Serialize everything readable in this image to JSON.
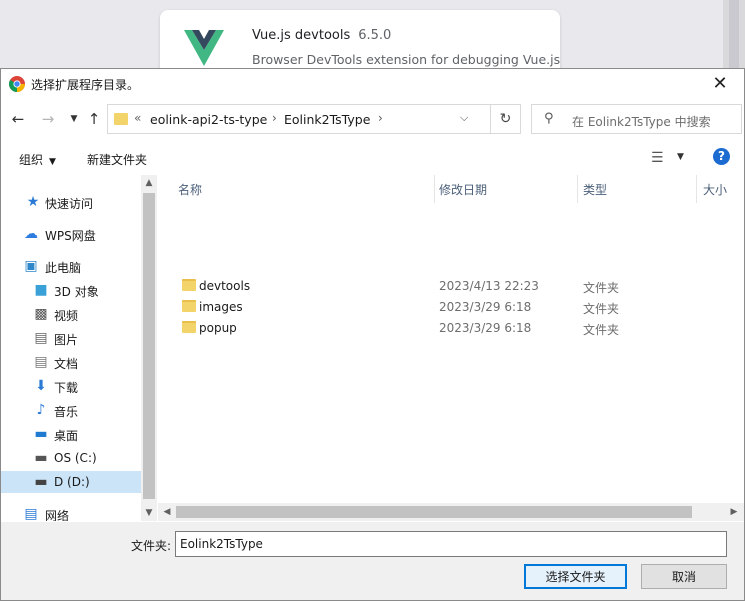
{
  "background": {
    "extension_name": "Vue.js devtools",
    "extension_version": "6.5.0",
    "extension_description": "Browser DevTools extension for debugging Vue.js"
  },
  "dialog": {
    "title": "选择扩展程序目录。",
    "close_glyph": "✕"
  },
  "address": {
    "overflow_glyph": "«",
    "crumbs": [
      "eolink-api2-ts-type",
      "Eolink2TsType"
    ],
    "separator": "›",
    "search_placeholder": "在 Eolink2TsType 中搜索"
  },
  "toolbar": {
    "organize": "组织",
    "new_folder": "新建文件夹"
  },
  "nav": {
    "items": [
      {
        "label": "快速访问",
        "icon": "star-icon"
      },
      {
        "label": "WPS网盘",
        "icon": "cloud-icon"
      },
      {
        "label": "此电脑",
        "icon": "computer-icon"
      },
      {
        "label": "3D 对象",
        "icon": "cube-icon"
      },
      {
        "label": "视频",
        "icon": "video-icon"
      },
      {
        "label": "图片",
        "icon": "picture-icon"
      },
      {
        "label": "文档",
        "icon": "document-icon"
      },
      {
        "label": "下载",
        "icon": "download-icon"
      },
      {
        "label": "音乐",
        "icon": "music-icon"
      },
      {
        "label": "桌面",
        "icon": "desktop-icon"
      },
      {
        "label": "OS (C:)",
        "icon": "drive-icon"
      },
      {
        "label": "D (D:)",
        "icon": "drive-icon",
        "selected": true
      },
      {
        "label": "网络",
        "icon": "network-icon"
      }
    ]
  },
  "files": {
    "columns": {
      "name": "名称",
      "modified": "修改日期",
      "type": "类型",
      "size": "大小"
    },
    "rows": [
      {
        "name": "devtools",
        "modified": "2023/4/13 22:23",
        "type": "文件夹"
      },
      {
        "name": "images",
        "modified": "2023/3/29 6:18",
        "type": "文件夹"
      },
      {
        "name": "popup",
        "modified": "2023/3/29 6:18",
        "type": "文件夹"
      }
    ]
  },
  "footer": {
    "folder_label": "文件夹:",
    "folder_value": "Eolink2TsType",
    "select_button": "选择文件夹",
    "cancel_button": "取消"
  },
  "colors": {
    "accent": "#0078d7",
    "selection": "#cce4f7",
    "folder": "#f3d46b",
    "vue_green": "#41b883",
    "vue_dark": "#35495e"
  }
}
